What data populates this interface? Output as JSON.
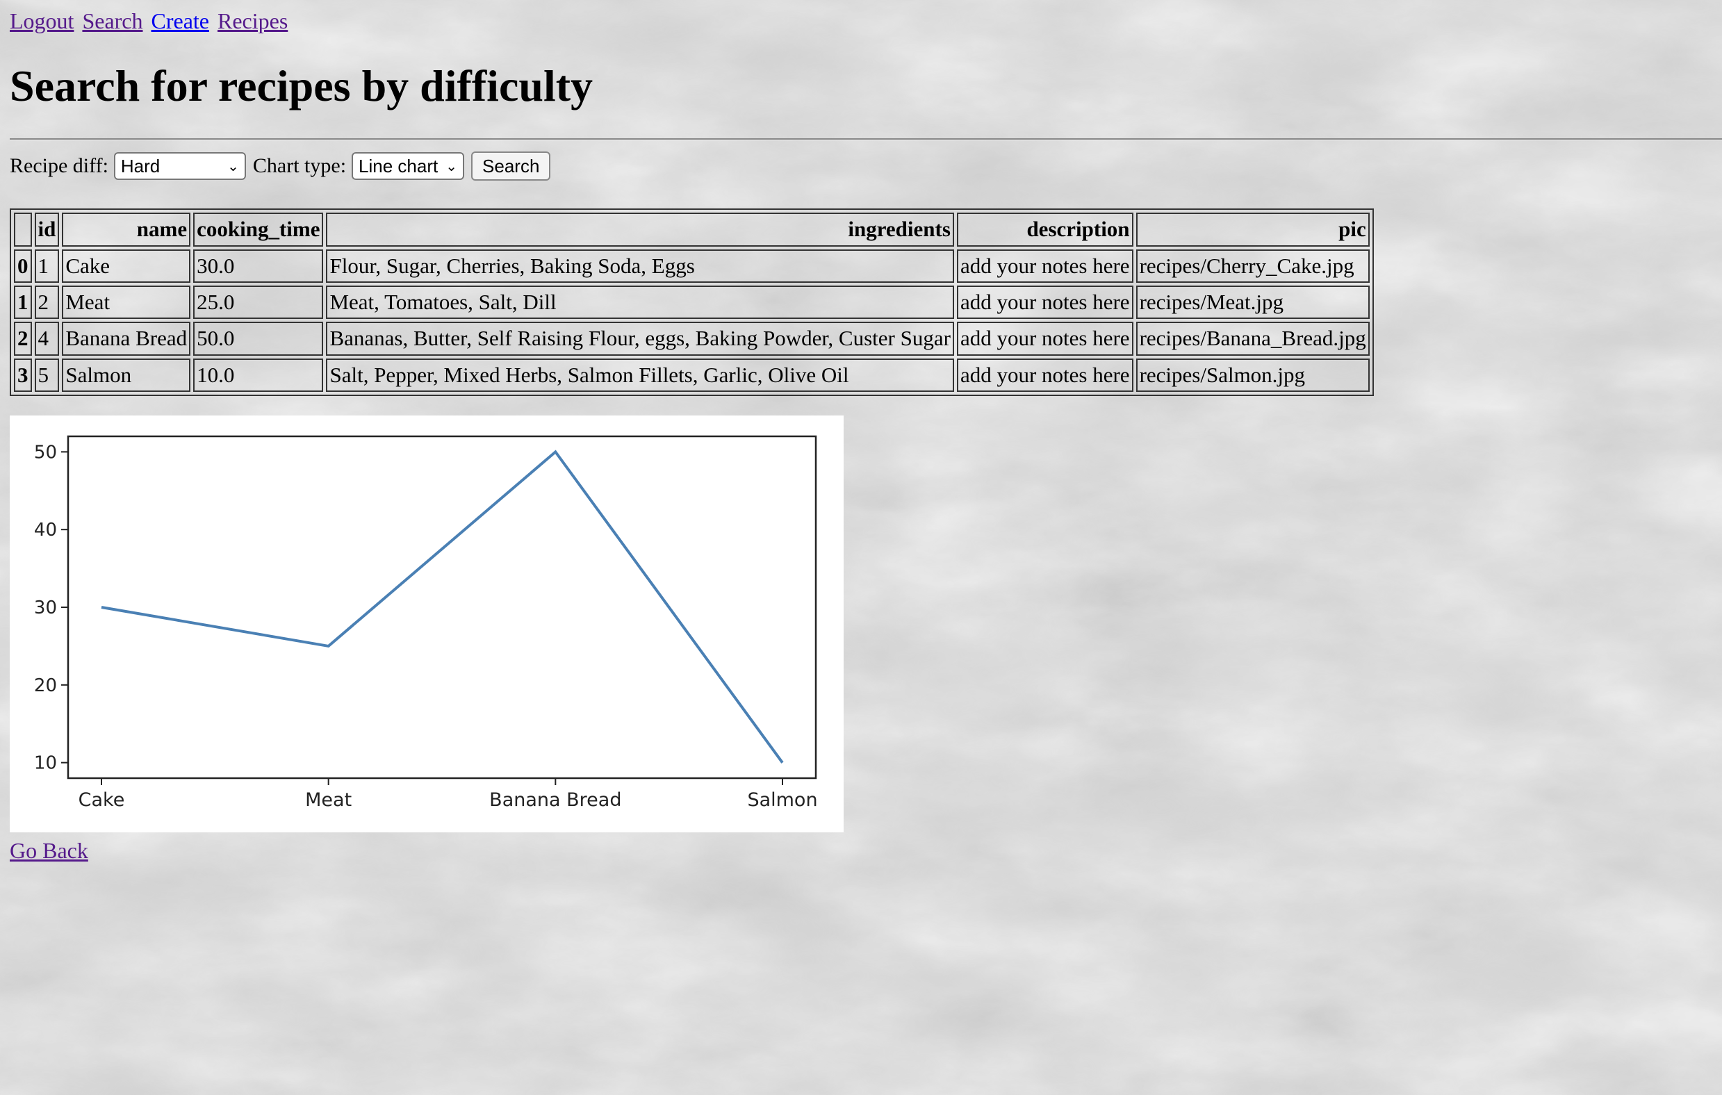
{
  "nav": {
    "links": [
      "Logout",
      "Search",
      "Create",
      "Recipes"
    ]
  },
  "page_title": "Search for recipes by difficulty",
  "form": {
    "recipe_diff_label": "Recipe diff:",
    "recipe_diff_value": "Hard",
    "chart_type_label": "Chart type:",
    "chart_type_value": "Line chart",
    "search_button": "Search"
  },
  "table": {
    "headers": [
      "",
      "id",
      "name",
      "cooking_time",
      "ingredients",
      "description",
      "pic"
    ],
    "rows": [
      [
        "0",
        "1",
        "Cake",
        "30.0",
        "Flour, Sugar, Cherries, Baking Soda, Eggs",
        "add your notes here",
        "recipes/Cherry_Cake.jpg"
      ],
      [
        "1",
        "2",
        "Meat",
        "25.0",
        "Meat, Tomatoes, Salt, Dill",
        "add your notes here",
        "recipes/Meat.jpg"
      ],
      [
        "2",
        "4",
        "Banana Bread",
        "50.0",
        "Bananas, Butter, Self Raising Flour, eggs, Baking Powder, Custer Sugar",
        "add your notes here",
        "recipes/Banana_Bread.jpg"
      ],
      [
        "3",
        "5",
        "Salmon",
        "10.0",
        "Salt, Pepper, Mixed Herbs, Salmon Fillets, Garlic, Olive Oil",
        "add your notes here",
        "recipes/Salmon.jpg"
      ]
    ]
  },
  "chart_data": {
    "type": "line",
    "categories": [
      "Cake",
      "Meat",
      "Banana Bread",
      "Salmon"
    ],
    "values": [
      30,
      25,
      50,
      10
    ],
    "yticks": [
      10,
      20,
      30,
      40,
      50
    ],
    "ylim": [
      8,
      52
    ],
    "line_color": "#4a80b4",
    "grid": false
  },
  "go_back": "Go Back"
}
